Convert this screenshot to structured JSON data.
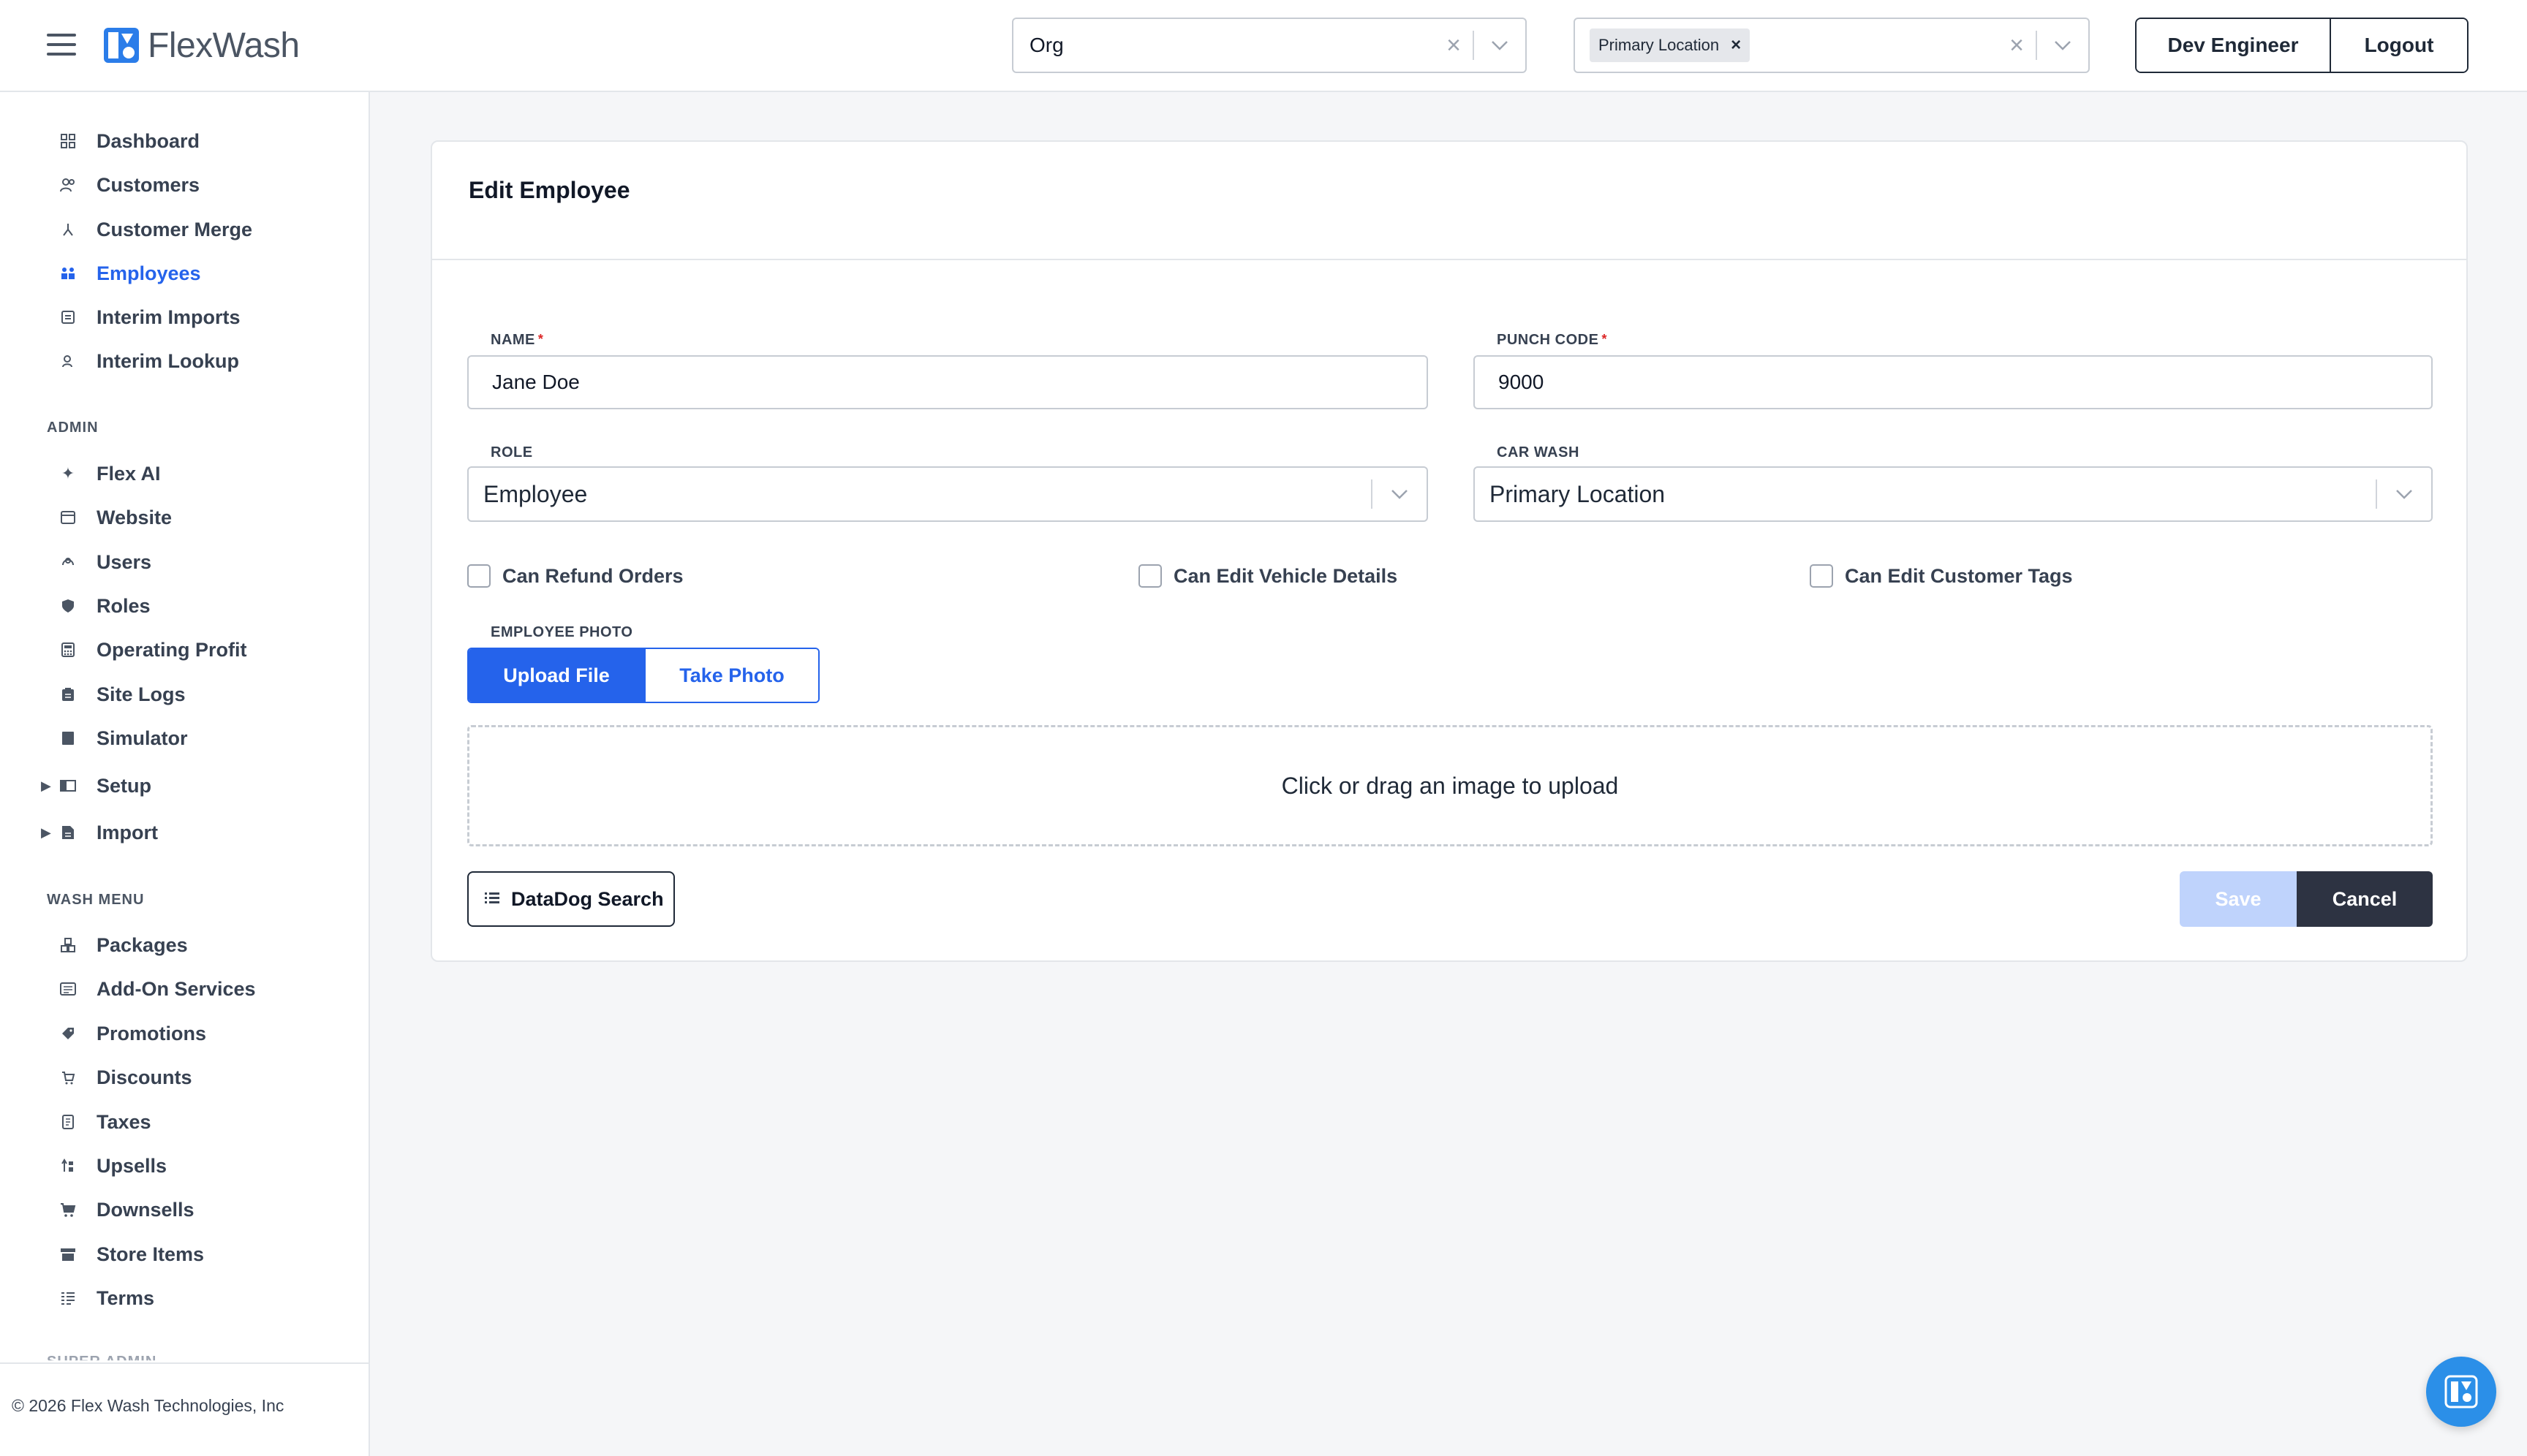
{
  "header": {
    "brand": "FlexWash",
    "org_select": {
      "value": "Org"
    },
    "location_select": {
      "chip": "Primary Location"
    },
    "user_button": "Dev Engineer",
    "logout_button": "Logout"
  },
  "sidebar": {
    "main_items": [
      {
        "label": "Dashboard",
        "icon": "dashboard-icon"
      },
      {
        "label": "Customers",
        "icon": "customers-icon"
      },
      {
        "label": "Customer Merge",
        "icon": "merge-icon"
      },
      {
        "label": "Employees",
        "icon": "employees-icon",
        "active": true
      },
      {
        "label": "Interim Imports",
        "icon": "imports-icon"
      },
      {
        "label": "Interim Lookup",
        "icon": "lookup-icon"
      }
    ],
    "admin_heading": "ADMIN",
    "admin_items": [
      {
        "label": "Flex AI",
        "icon": "sparkle-icon"
      },
      {
        "label": "Website",
        "icon": "website-icon"
      },
      {
        "label": "Users",
        "icon": "users-icon"
      },
      {
        "label": "Roles",
        "icon": "shield-icon"
      },
      {
        "label": "Operating Profit",
        "icon": "calculator-icon"
      },
      {
        "label": "Site Logs",
        "icon": "clipboard-icon"
      },
      {
        "label": "Simulator",
        "icon": "book-icon"
      },
      {
        "label": "Setup",
        "icon": "setup-icon",
        "expandable": true
      },
      {
        "label": "Import",
        "icon": "file-icon",
        "expandable": true
      }
    ],
    "wash_heading": "WASH MENU",
    "wash_items": [
      {
        "label": "Packages",
        "icon": "packages-icon"
      },
      {
        "label": "Add-On Services",
        "icon": "addon-icon"
      },
      {
        "label": "Promotions",
        "icon": "tag-icon"
      },
      {
        "label": "Discounts",
        "icon": "discount-icon"
      },
      {
        "label": "Taxes",
        "icon": "taxes-icon"
      },
      {
        "label": "Upsells",
        "icon": "upsell-icon"
      },
      {
        "label": "Downsells",
        "icon": "cart-icon"
      },
      {
        "label": "Store Items",
        "icon": "store-icon"
      },
      {
        "label": "Terms",
        "icon": "terms-icon"
      }
    ],
    "next_heading_partial": "SUPER ADMIN",
    "footer": "© 2026 Flex Wash Technologies, Inc"
  },
  "form": {
    "title": "Edit Employee",
    "name_label": "NAME",
    "name_value": "Jane Doe",
    "punch_label": "PUNCH CODE",
    "punch_value": "9000",
    "role_label": "ROLE",
    "role_value": "Employee",
    "carwash_label": "CAR WASH",
    "carwash_value": "Primary Location",
    "checkboxes": [
      {
        "label": "Can Refund Orders",
        "checked": false
      },
      {
        "label": "Can Edit Vehicle Details",
        "checked": false
      },
      {
        "label": "Can Edit Customer Tags",
        "checked": false
      }
    ],
    "photo_label": "EMPLOYEE PHOTO",
    "upload_button": "Upload File",
    "take_photo_button": "Take Photo",
    "dropzone_text": "Click or drag an image to upload",
    "datadog_button": "DataDog Search",
    "save_button": "Save",
    "cancel_button": "Cancel"
  },
  "colors": {
    "accent": "#2563eb",
    "dark": "#2d3342",
    "save_disabled": "#bfd3fc"
  }
}
